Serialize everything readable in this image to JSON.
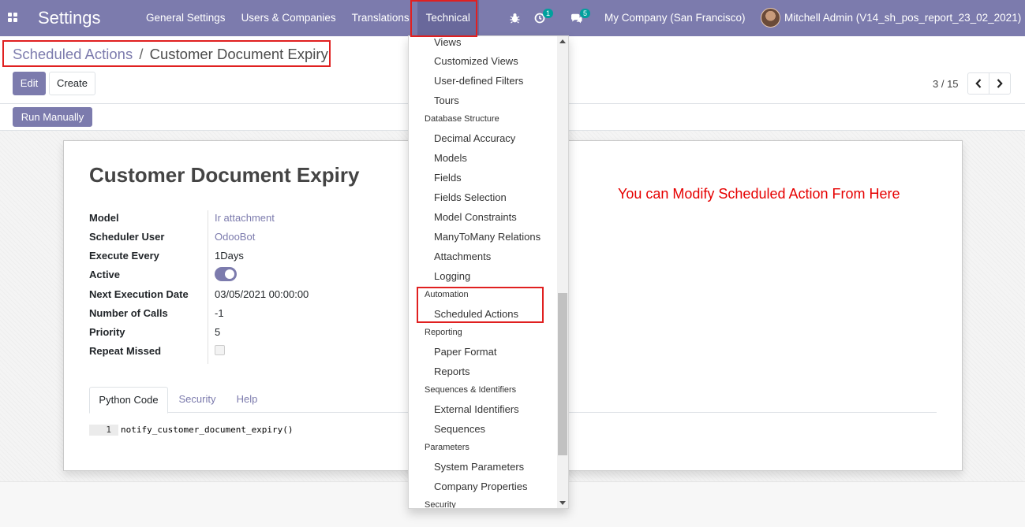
{
  "navbar": {
    "app_title": "Settings",
    "menu": [
      "General Settings",
      "Users & Companies",
      "Translations",
      "Technical"
    ],
    "activity_count": "1",
    "message_count": "5",
    "company": "My Company (San Francisco)",
    "user": "Mitchell Admin (V14_sh_pos_report_23_02_2021)"
  },
  "breadcrumb": {
    "parent": "Scheduled Actions",
    "separator": "/",
    "current": "Customer Document Expiry"
  },
  "control_panel": {
    "edit_label": "Edit",
    "create_label": "Create",
    "pager_value": "3 / 15",
    "run_manually_label": "Run Manually"
  },
  "form": {
    "title": "Customer Document Expiry",
    "note": "You can Modify Scheduled Action From Here",
    "fields": [
      {
        "label": "Model",
        "value": "Ir attachment"
      },
      {
        "label": "Scheduler User",
        "value": "OdooBot"
      },
      {
        "label": "Execute Every",
        "value": "1Days"
      },
      {
        "label": "Active",
        "value": ""
      },
      {
        "label": "Next Execution Date",
        "value": "03/05/2021 00:00:00"
      },
      {
        "label": "Number of Calls",
        "value": "-1"
      },
      {
        "label": "Priority",
        "value": "5"
      },
      {
        "label": "Repeat Missed",
        "value": ""
      }
    ],
    "active": true,
    "repeat_missed": false,
    "tabs": [
      "Python Code",
      "Security",
      "Help"
    ],
    "code": {
      "line_number": "1",
      "text": "notify_customer_document_expiry()"
    }
  },
  "dropdown": {
    "entries": [
      {
        "type": "item",
        "label": "Views"
      },
      {
        "type": "item",
        "label": "Customized Views"
      },
      {
        "type": "item",
        "label": "User-defined Filters"
      },
      {
        "type": "item",
        "label": "Tours"
      },
      {
        "type": "header",
        "label": "Database Structure"
      },
      {
        "type": "item",
        "label": "Decimal Accuracy"
      },
      {
        "type": "item",
        "label": "Models"
      },
      {
        "type": "item",
        "label": "Fields"
      },
      {
        "type": "item",
        "label": "Fields Selection"
      },
      {
        "type": "item",
        "label": "Model Constraints"
      },
      {
        "type": "item",
        "label": "ManyToMany Relations"
      },
      {
        "type": "item",
        "label": "Attachments"
      },
      {
        "type": "item",
        "label": "Logging"
      },
      {
        "type": "header",
        "label": "Automation"
      },
      {
        "type": "item",
        "label": "Scheduled Actions"
      },
      {
        "type": "header",
        "label": "Reporting"
      },
      {
        "type": "item",
        "label": "Paper Format"
      },
      {
        "type": "item",
        "label": "Reports"
      },
      {
        "type": "header",
        "label": "Sequences & Identifiers"
      },
      {
        "type": "item",
        "label": "External Identifiers"
      },
      {
        "type": "item",
        "label": "Sequences"
      },
      {
        "type": "header",
        "label": "Parameters"
      },
      {
        "type": "item",
        "label": "System Parameters"
      },
      {
        "type": "item",
        "label": "Company Properties"
      },
      {
        "type": "header",
        "label": "Security"
      }
    ]
  },
  "colors": {
    "brand": "#7c7bad",
    "annotation": "#e02020",
    "note_text": "#e60000"
  }
}
